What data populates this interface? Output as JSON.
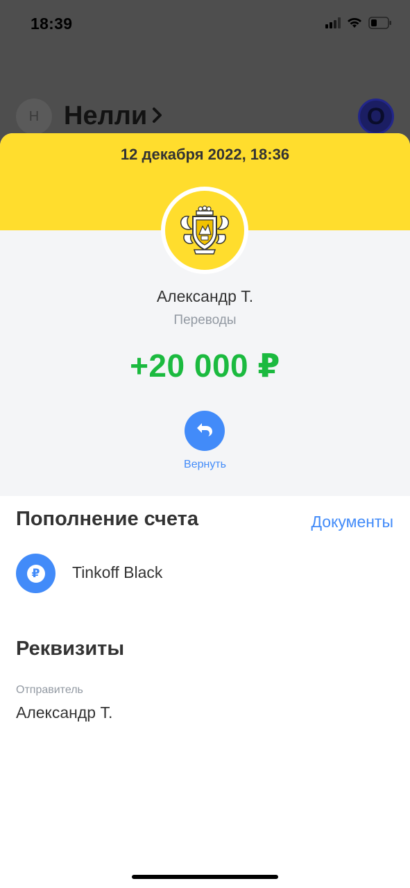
{
  "status_bar": {
    "time": "18:39",
    "icons": [
      "cellular-signal-icon",
      "wifi-icon",
      "battery-icon"
    ]
  },
  "background": {
    "avatar_letter": "Н",
    "contact_name": "Нелли",
    "chevron": "›",
    "right_avatar_letter": "О"
  },
  "operation": {
    "date": "12 декабря 2022, 18:36",
    "sender": "Александр Т.",
    "category": "Переводы",
    "amount": "+20 000 ₽",
    "return_label": "Вернуть"
  },
  "account_section": {
    "title": "Пополнение счета",
    "documents_link": "Документы",
    "account_name": "Tinkoff Black",
    "account_icon_symbol": "₽"
  },
  "details_section": {
    "title": "Реквизиты",
    "sender_label": "Отправитель",
    "sender_value": "Александр Т."
  },
  "colors": {
    "brand_yellow": "#ffdd2d",
    "accent_blue": "#428bf9",
    "amount_green": "#1bba3f",
    "dimmed_overlay": "#4e4e4e"
  }
}
